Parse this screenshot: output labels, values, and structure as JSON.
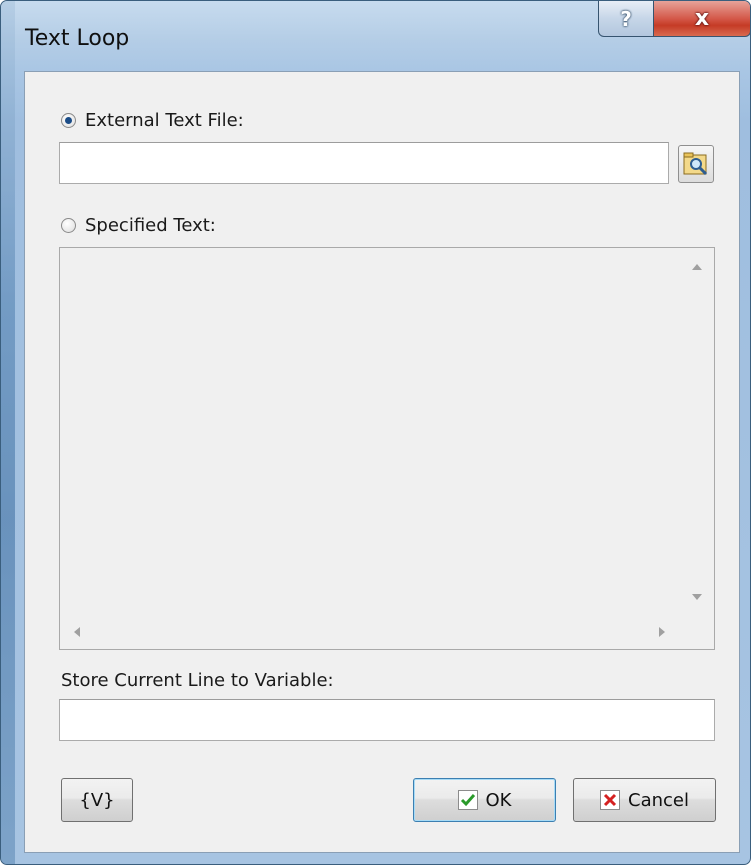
{
  "window": {
    "title": "Text Loop",
    "help_glyph": "?",
    "close_glyph": "x"
  },
  "source": {
    "external_label": "External Text File:",
    "external_selected": true,
    "external_value": "",
    "specified_label": "Specified Text:",
    "specified_value": ""
  },
  "store": {
    "label": "Store Current Line to Variable:",
    "value": ""
  },
  "buttons": {
    "variables": "{V}",
    "ok": "OK",
    "cancel": "Cancel"
  },
  "colors": {
    "ok_check": "#2a9a2a",
    "cancel_x": "#d42121"
  }
}
